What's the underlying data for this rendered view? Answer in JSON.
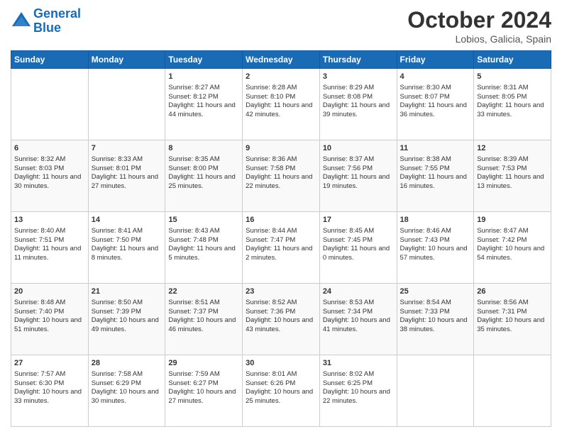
{
  "header": {
    "logo_line1": "General",
    "logo_line2": "Blue",
    "month": "October 2024",
    "location": "Lobios, Galicia, Spain"
  },
  "days_of_week": [
    "Sunday",
    "Monday",
    "Tuesday",
    "Wednesday",
    "Thursday",
    "Friday",
    "Saturday"
  ],
  "weeks": [
    [
      {
        "day": "",
        "sunrise": "",
        "sunset": "",
        "daylight": ""
      },
      {
        "day": "",
        "sunrise": "",
        "sunset": "",
        "daylight": ""
      },
      {
        "day": "1",
        "sunrise": "Sunrise: 8:27 AM",
        "sunset": "Sunset: 8:12 PM",
        "daylight": "Daylight: 11 hours and 44 minutes."
      },
      {
        "day": "2",
        "sunrise": "Sunrise: 8:28 AM",
        "sunset": "Sunset: 8:10 PM",
        "daylight": "Daylight: 11 hours and 42 minutes."
      },
      {
        "day": "3",
        "sunrise": "Sunrise: 8:29 AM",
        "sunset": "Sunset: 8:08 PM",
        "daylight": "Daylight: 11 hours and 39 minutes."
      },
      {
        "day": "4",
        "sunrise": "Sunrise: 8:30 AM",
        "sunset": "Sunset: 8:07 PM",
        "daylight": "Daylight: 11 hours and 36 minutes."
      },
      {
        "day": "5",
        "sunrise": "Sunrise: 8:31 AM",
        "sunset": "Sunset: 8:05 PM",
        "daylight": "Daylight: 11 hours and 33 minutes."
      }
    ],
    [
      {
        "day": "6",
        "sunrise": "Sunrise: 8:32 AM",
        "sunset": "Sunset: 8:03 PM",
        "daylight": "Daylight: 11 hours and 30 minutes."
      },
      {
        "day": "7",
        "sunrise": "Sunrise: 8:33 AM",
        "sunset": "Sunset: 8:01 PM",
        "daylight": "Daylight: 11 hours and 27 minutes."
      },
      {
        "day": "8",
        "sunrise": "Sunrise: 8:35 AM",
        "sunset": "Sunset: 8:00 PM",
        "daylight": "Daylight: 11 hours and 25 minutes."
      },
      {
        "day": "9",
        "sunrise": "Sunrise: 8:36 AM",
        "sunset": "Sunset: 7:58 PM",
        "daylight": "Daylight: 11 hours and 22 minutes."
      },
      {
        "day": "10",
        "sunrise": "Sunrise: 8:37 AM",
        "sunset": "Sunset: 7:56 PM",
        "daylight": "Daylight: 11 hours and 19 minutes."
      },
      {
        "day": "11",
        "sunrise": "Sunrise: 8:38 AM",
        "sunset": "Sunset: 7:55 PM",
        "daylight": "Daylight: 11 hours and 16 minutes."
      },
      {
        "day": "12",
        "sunrise": "Sunrise: 8:39 AM",
        "sunset": "Sunset: 7:53 PM",
        "daylight": "Daylight: 11 hours and 13 minutes."
      }
    ],
    [
      {
        "day": "13",
        "sunrise": "Sunrise: 8:40 AM",
        "sunset": "Sunset: 7:51 PM",
        "daylight": "Daylight: 11 hours and 11 minutes."
      },
      {
        "day": "14",
        "sunrise": "Sunrise: 8:41 AM",
        "sunset": "Sunset: 7:50 PM",
        "daylight": "Daylight: 11 hours and 8 minutes."
      },
      {
        "day": "15",
        "sunrise": "Sunrise: 8:43 AM",
        "sunset": "Sunset: 7:48 PM",
        "daylight": "Daylight: 11 hours and 5 minutes."
      },
      {
        "day": "16",
        "sunrise": "Sunrise: 8:44 AM",
        "sunset": "Sunset: 7:47 PM",
        "daylight": "Daylight: 11 hours and 2 minutes."
      },
      {
        "day": "17",
        "sunrise": "Sunrise: 8:45 AM",
        "sunset": "Sunset: 7:45 PM",
        "daylight": "Daylight: 11 hours and 0 minutes."
      },
      {
        "day": "18",
        "sunrise": "Sunrise: 8:46 AM",
        "sunset": "Sunset: 7:43 PM",
        "daylight": "Daylight: 10 hours and 57 minutes."
      },
      {
        "day": "19",
        "sunrise": "Sunrise: 8:47 AM",
        "sunset": "Sunset: 7:42 PM",
        "daylight": "Daylight: 10 hours and 54 minutes."
      }
    ],
    [
      {
        "day": "20",
        "sunrise": "Sunrise: 8:48 AM",
        "sunset": "Sunset: 7:40 PM",
        "daylight": "Daylight: 10 hours and 51 minutes."
      },
      {
        "day": "21",
        "sunrise": "Sunrise: 8:50 AM",
        "sunset": "Sunset: 7:39 PM",
        "daylight": "Daylight: 10 hours and 49 minutes."
      },
      {
        "day": "22",
        "sunrise": "Sunrise: 8:51 AM",
        "sunset": "Sunset: 7:37 PM",
        "daylight": "Daylight: 10 hours and 46 minutes."
      },
      {
        "day": "23",
        "sunrise": "Sunrise: 8:52 AM",
        "sunset": "Sunset: 7:36 PM",
        "daylight": "Daylight: 10 hours and 43 minutes."
      },
      {
        "day": "24",
        "sunrise": "Sunrise: 8:53 AM",
        "sunset": "Sunset: 7:34 PM",
        "daylight": "Daylight: 10 hours and 41 minutes."
      },
      {
        "day": "25",
        "sunrise": "Sunrise: 8:54 AM",
        "sunset": "Sunset: 7:33 PM",
        "daylight": "Daylight: 10 hours and 38 minutes."
      },
      {
        "day": "26",
        "sunrise": "Sunrise: 8:56 AM",
        "sunset": "Sunset: 7:31 PM",
        "daylight": "Daylight: 10 hours and 35 minutes."
      }
    ],
    [
      {
        "day": "27",
        "sunrise": "Sunrise: 7:57 AM",
        "sunset": "Sunset: 6:30 PM",
        "daylight": "Daylight: 10 hours and 33 minutes."
      },
      {
        "day": "28",
        "sunrise": "Sunrise: 7:58 AM",
        "sunset": "Sunset: 6:29 PM",
        "daylight": "Daylight: 10 hours and 30 minutes."
      },
      {
        "day": "29",
        "sunrise": "Sunrise: 7:59 AM",
        "sunset": "Sunset: 6:27 PM",
        "daylight": "Daylight: 10 hours and 27 minutes."
      },
      {
        "day": "30",
        "sunrise": "Sunrise: 8:01 AM",
        "sunset": "Sunset: 6:26 PM",
        "daylight": "Daylight: 10 hours and 25 minutes."
      },
      {
        "day": "31",
        "sunrise": "Sunrise: 8:02 AM",
        "sunset": "Sunset: 6:25 PM",
        "daylight": "Daylight: 10 hours and 22 minutes."
      },
      {
        "day": "",
        "sunrise": "",
        "sunset": "",
        "daylight": ""
      },
      {
        "day": "",
        "sunrise": "",
        "sunset": "",
        "daylight": ""
      }
    ]
  ]
}
